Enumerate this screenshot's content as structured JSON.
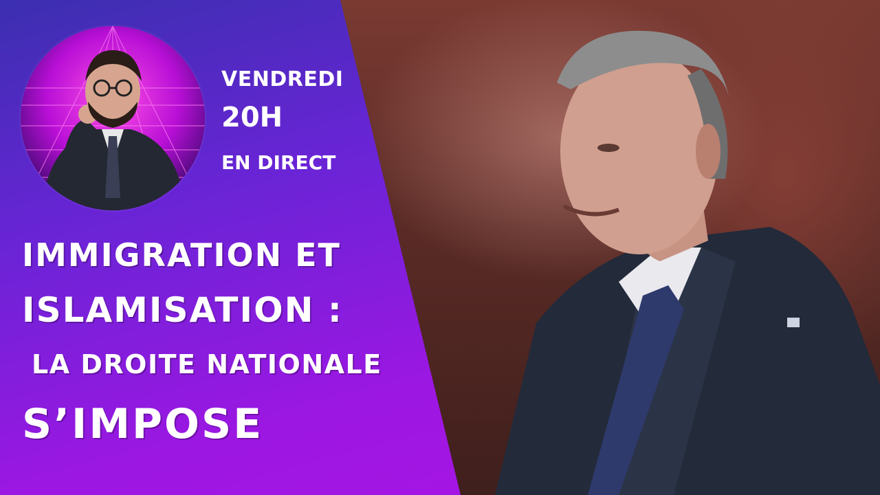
{
  "broadcast": {
    "day": "VENDREDI",
    "time": "20H",
    "mode": "EN DIRECT"
  },
  "headline": {
    "line1": "IMMIGRATION ET",
    "line2": "ISLAMISATION :",
    "line3": "LA DROITE NATIONALE",
    "line4": "S’IMPOSE"
  },
  "colors": {
    "panel_top": "#3b2fb0",
    "panel_bottom": "#a515e3",
    "text": "#ffffff",
    "avatar_bg": "#a00fd0"
  }
}
